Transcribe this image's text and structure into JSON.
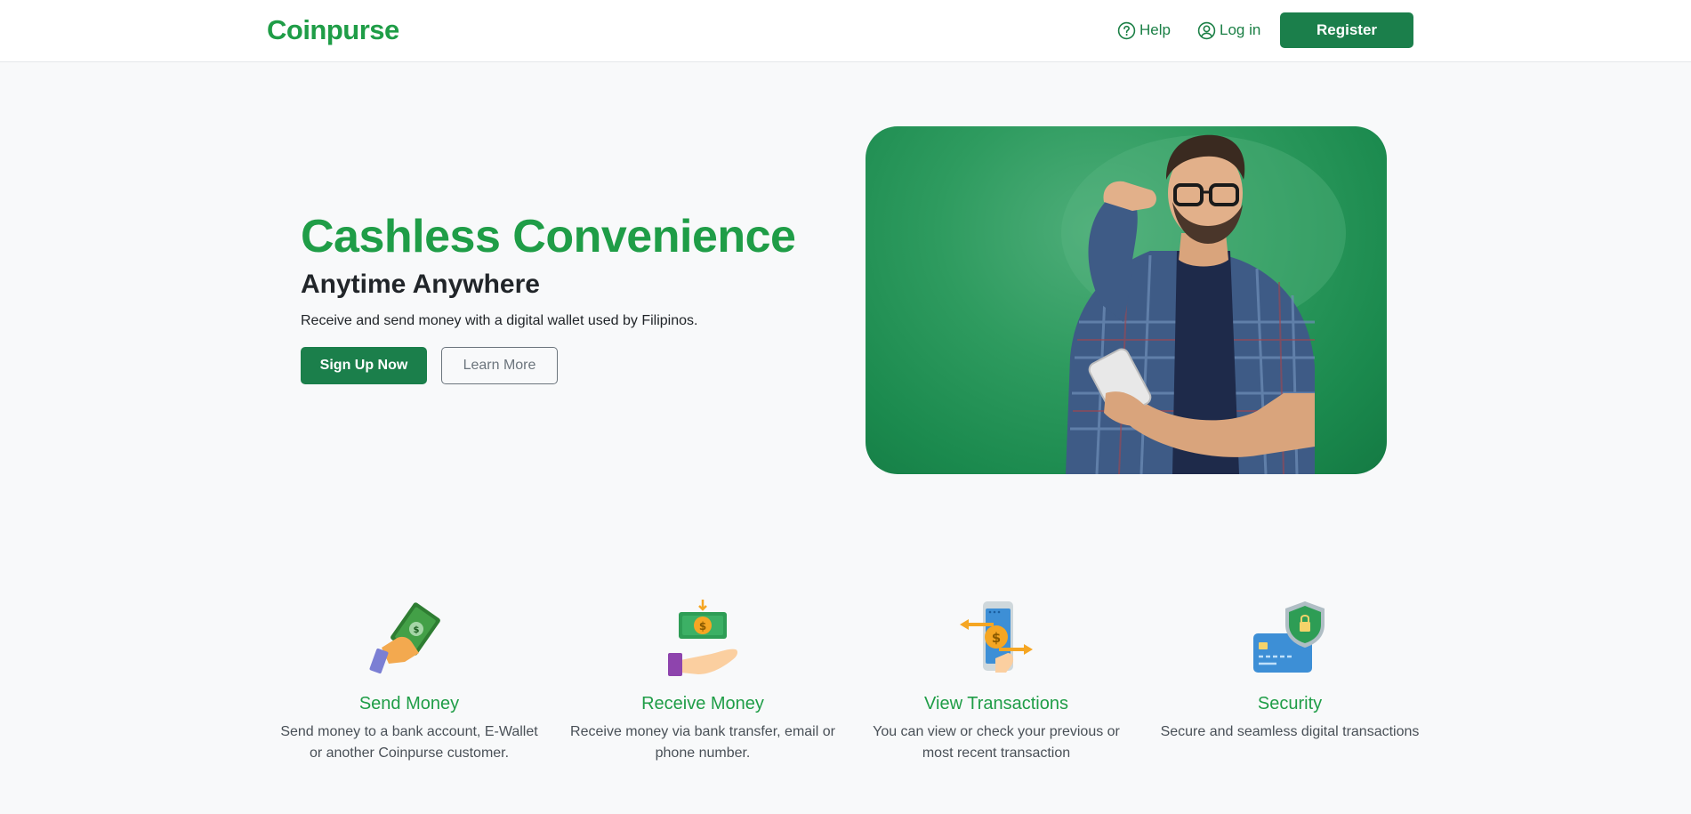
{
  "navbar": {
    "brand": "Coinpurse",
    "help_label": "Help",
    "login_label": "Log in",
    "register_label": "Register"
  },
  "hero": {
    "title": "Cashless Convenience",
    "subtitle": "Anytime Anywhere",
    "description": "Receive and send money with a digital wallet used by Filipinos.",
    "primary_button": "Sign Up Now",
    "secondary_button": "Learn More",
    "image_icon": "man-with-phone-photo"
  },
  "features": [
    {
      "icon": "hand-cash-icon",
      "title": "Send Money",
      "description": "Send money to a bank account, E-Wallet or another Coinpurse customer."
    },
    {
      "icon": "receive-money-icon",
      "title": "Receive Money",
      "description": "Receive money via bank transfer, email or phone number."
    },
    {
      "icon": "phone-transactions-icon",
      "title": "View Transactions",
      "description": "You can view or check your previous or most recent transaction"
    },
    {
      "icon": "secure-card-icon",
      "title": "Security",
      "description": "Secure and seamless digital transactions"
    }
  ],
  "colors": {
    "brand_green": "#1f9d47",
    "button_green": "#1b7f4b",
    "background": "#f8f9fa"
  }
}
